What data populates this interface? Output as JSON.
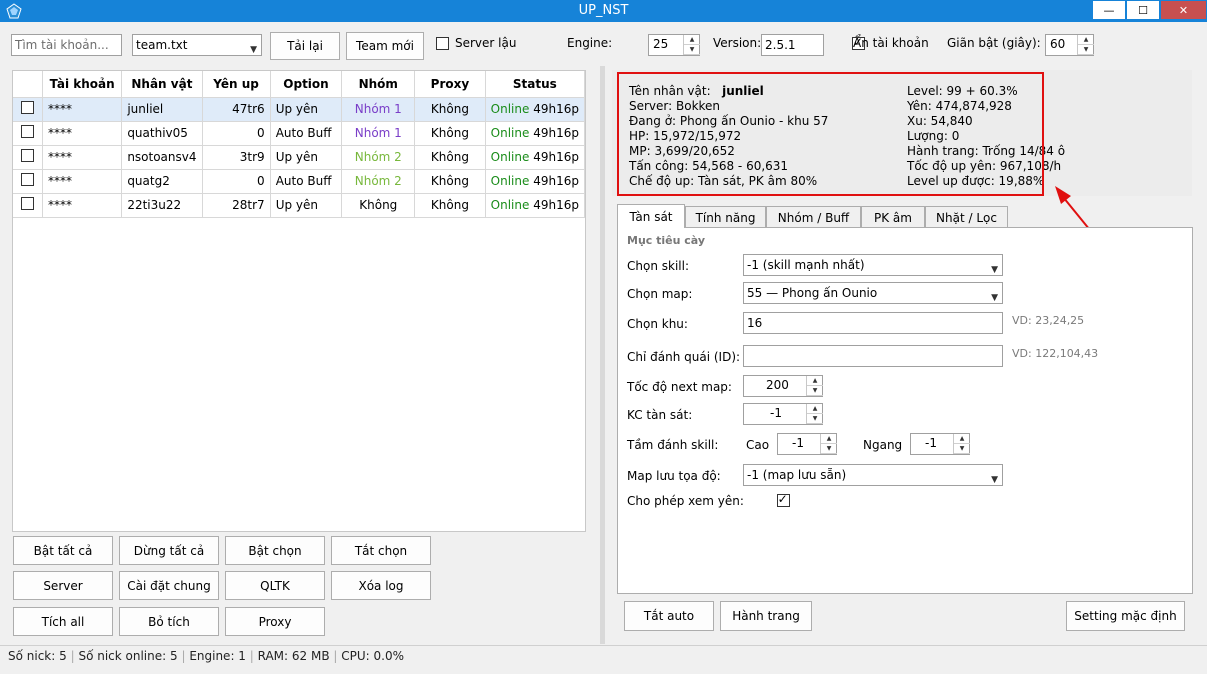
{
  "window": {
    "title": "UP_NST"
  },
  "toolbar": {
    "search_placeholder": "Tìm tài khoản...",
    "team_file": "team.txt",
    "reload_label": "Tải lại",
    "new_team_label": "Team mới",
    "server_lau_label": "Server lậu",
    "engine_label": "Engine:",
    "engine_value": "25",
    "version_label": "Version:",
    "version_value": "2.5.1",
    "hide_account_label": "Ẩn tài khoản",
    "delay_label": "Giãn bật (giây):",
    "delay_value": "60"
  },
  "table": {
    "headers": [
      "",
      "Tài khoản",
      "Nhân vật",
      "Yên up",
      "Option",
      "Nhóm",
      "Proxy",
      "Status"
    ],
    "rows": [
      {
        "account": "****",
        "character": "junliel",
        "yen": "47tr6",
        "option": "Up yên",
        "group": "Nhóm 1",
        "proxy": "Không",
        "status": "Online",
        "time": "49h16p",
        "group_color": "purple"
      },
      {
        "account": "****",
        "character": "quathiv05",
        "yen": "0",
        "option": "Auto Buff",
        "group": "Nhóm 1",
        "proxy": "Không",
        "status": "Online",
        "time": "49h16p",
        "group_color": "purple"
      },
      {
        "account": "****",
        "character": "nsotoansv4",
        "yen": "3tr9",
        "option": "Up yên",
        "group": "Nhóm 2",
        "proxy": "Không",
        "status": "Online",
        "time": "49h16p",
        "group_color": "green"
      },
      {
        "account": "****",
        "character": "quatg2",
        "yen": "0",
        "option": "Auto Buff",
        "group": "Nhóm 2",
        "proxy": "Không",
        "status": "Online",
        "time": "49h16p",
        "group_color": "green"
      },
      {
        "account": "****",
        "character": "22ti3u22",
        "yen": "28tr7",
        "option": "Up yên",
        "group": "Không",
        "proxy": "Không",
        "status": "Online",
        "time": "49h16p",
        "group_color": "plain"
      }
    ]
  },
  "left_buttons": {
    "bat_tat_ca": "Bật tất cả",
    "dung_tat_ca": "Dừng tất cả",
    "bat_chon": "Bật chọn",
    "tat_chon": "Tắt chọn",
    "server": "Server",
    "cai_dat_chung": "Cài đặt chung",
    "qltk": "QLTK",
    "xoa_log": "Xóa log",
    "tich_all": "Tích all",
    "bo_tich": "Bỏ tích",
    "proxy": "Proxy"
  },
  "info": {
    "name_label": "Tên nhân vật:",
    "name_value": "junliel",
    "server": "Server: Bokken",
    "location": "Đang ở: Phong ấn Ounio - khu 57",
    "hp": "HP: 15,972/15,972",
    "mp": "MP: 3,699/20,652",
    "attack": "Tấn công: 54,568 - 60,631",
    "mode": "Chế độ up: Tàn sát, PK âm 80%",
    "level": "Level: 99 + 60.3%",
    "yen": "Yên: 474,874,928",
    "xu": "Xu: 54,840",
    "luong": "Lượng: 0",
    "inventory": "Hành trang: Trống 14/84 ô",
    "yen_speed": "Tốc độ up yên: 967,108/h",
    "level_gain": "Level up được: 19,88%"
  },
  "tabs": [
    "Tàn sát",
    "Tính năng",
    "Nhóm / Buff",
    "PK âm",
    "Nhặt / Lọc"
  ],
  "form": {
    "section_title": "Mục tiêu cày",
    "skill_label": "Chọn skill:",
    "skill_value": "-1 (skill mạnh nhất)",
    "map_label": "Chọn map:",
    "map_value": "55 — Phong ấn Ounio",
    "khu_label": "Chọn khu:",
    "khu_value": "16",
    "khu_hint": "VD: 23,24,25",
    "monster_label": "Chỉ đánh quái (ID):",
    "monster_value": "",
    "monster_hint": "VD: 122,104,43",
    "next_map_label": "Tốc độ next map:",
    "next_map_value": "200",
    "kc_label": "KC tàn sát:",
    "kc_value": "-1",
    "range_label": "Tầm đánh skill:",
    "cao_label": "Cao",
    "cao_value": "-1",
    "ngang_label": "Ngang",
    "ngang_value": "-1",
    "save_map_label": "Map lưu tọa độ:",
    "save_map_value": "-1 (map lưu sẵn)",
    "allow_view_label": "Cho phép xem yên:"
  },
  "bottom_buttons": {
    "tat_auto": "Tắt auto",
    "hanh_trang": "Hành trang",
    "setting": "Setting mặc định"
  },
  "status_bar": {
    "so_nick": "Số nick: 5",
    "so_online": "Số nick online: 5",
    "engine": "Engine: 1",
    "ram": "RAM: 62 MB",
    "cpu": "CPU: 0.0%"
  },
  "colors": {
    "titlebar": "#1683d8",
    "highlight": "#e01010",
    "online": "#1a8c1a"
  }
}
